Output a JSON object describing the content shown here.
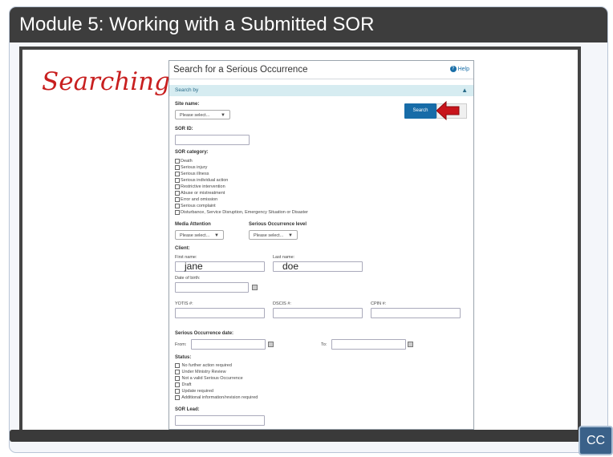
{
  "header": {
    "title": "Module 5:  Working with a Submitted SOR"
  },
  "slide": {
    "caption": "Searching"
  },
  "form": {
    "title": "Search for a Serious Occurrence",
    "help": "Help",
    "search_by": "Search by",
    "search_button": "Search",
    "site_name": {
      "label": "Site name:",
      "value": "Please select..."
    },
    "sor_id": {
      "label": "SOR ID:",
      "value": ""
    },
    "sor_category": {
      "label": "SOR category:",
      "options": [
        "Death",
        "Serious injury",
        "Serious illness",
        "Serious individual action",
        "Restrictive intervention",
        "Abuse or mistreatment",
        "Error and omission",
        "Serious complaint",
        "Disturbance, Service Disruption, Emergency Situation or Disaster"
      ]
    },
    "media_attention": {
      "label": "Media Attention",
      "value": "Please select..."
    },
    "so_level": {
      "label": "Serious Occurrence level",
      "value": "Please select..."
    },
    "client": {
      "label": "Client:",
      "first_name_label": "First name:",
      "first_name": "jane",
      "last_name_label": "Last name:",
      "last_name": "doe",
      "dob_label": "Date of birth:",
      "yotis_label": "YOTIS #:",
      "dscis_label": "DSCIS #:",
      "cpin_label": "CPIN #:"
    },
    "so_date": {
      "label": "Serious Occurrence date:",
      "from_label": "From:",
      "to_label": "To:"
    },
    "status": {
      "label": "Status:",
      "options": [
        "No further action required",
        "Under Ministry Review",
        "Not a valid Serious Occurrence",
        "Draft",
        "Update required",
        "Additional information/revision required"
      ]
    },
    "sor_lead": {
      "label": "SOR Lead:"
    }
  },
  "player": {
    "cc_label": "CC"
  },
  "colors": {
    "accent": "#176ca8",
    "caption": "#c81f1f",
    "arrow": "#c8141c",
    "header_bg": "#3d3d3d"
  },
  "icons": [
    "help-icon",
    "chevron-up-icon",
    "calendar-icon",
    "red-arrow-icon"
  ]
}
